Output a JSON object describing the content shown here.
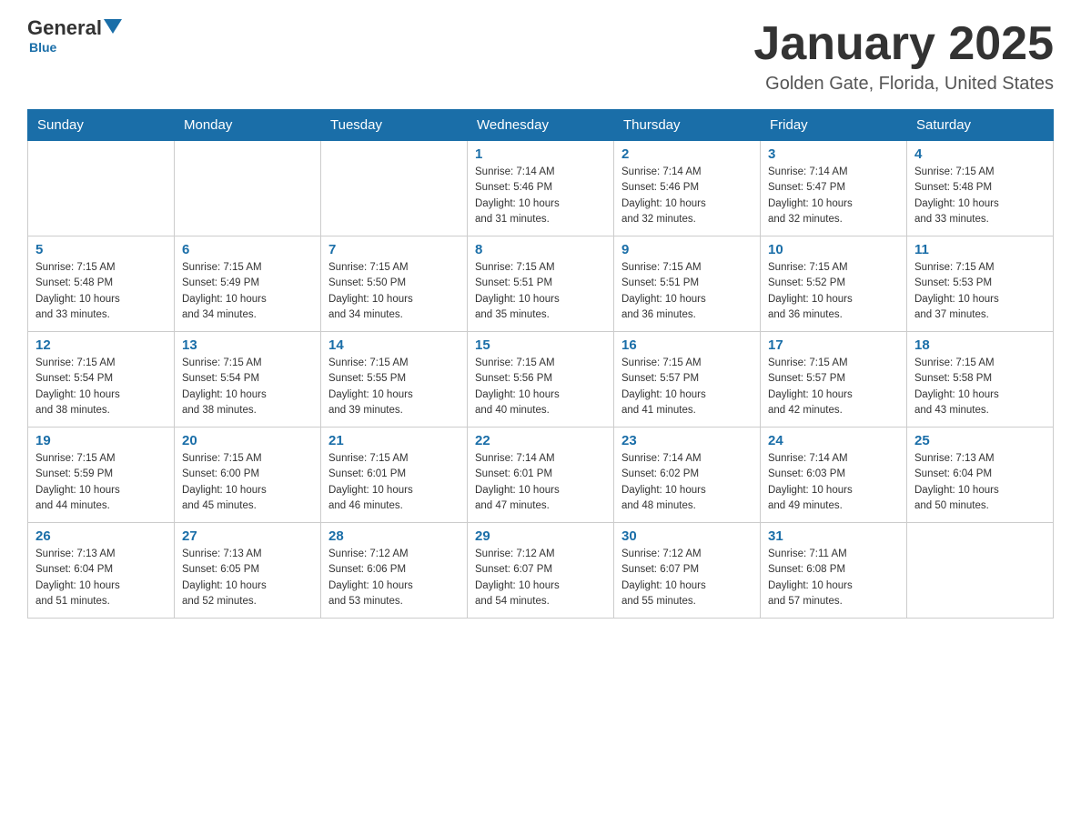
{
  "header": {
    "logo_general": "General",
    "logo_blue": "Blue",
    "month_title": "January 2025",
    "location": "Golden Gate, Florida, United States"
  },
  "columns": [
    "Sunday",
    "Monday",
    "Tuesday",
    "Wednesday",
    "Thursday",
    "Friday",
    "Saturday"
  ],
  "weeks": [
    [
      {
        "day": "",
        "info": ""
      },
      {
        "day": "",
        "info": ""
      },
      {
        "day": "",
        "info": ""
      },
      {
        "day": "1",
        "info": "Sunrise: 7:14 AM\nSunset: 5:46 PM\nDaylight: 10 hours\nand 31 minutes."
      },
      {
        "day": "2",
        "info": "Sunrise: 7:14 AM\nSunset: 5:46 PM\nDaylight: 10 hours\nand 32 minutes."
      },
      {
        "day": "3",
        "info": "Sunrise: 7:14 AM\nSunset: 5:47 PM\nDaylight: 10 hours\nand 32 minutes."
      },
      {
        "day": "4",
        "info": "Sunrise: 7:15 AM\nSunset: 5:48 PM\nDaylight: 10 hours\nand 33 minutes."
      }
    ],
    [
      {
        "day": "5",
        "info": "Sunrise: 7:15 AM\nSunset: 5:48 PM\nDaylight: 10 hours\nand 33 minutes."
      },
      {
        "day": "6",
        "info": "Sunrise: 7:15 AM\nSunset: 5:49 PM\nDaylight: 10 hours\nand 34 minutes."
      },
      {
        "day": "7",
        "info": "Sunrise: 7:15 AM\nSunset: 5:50 PM\nDaylight: 10 hours\nand 34 minutes."
      },
      {
        "day": "8",
        "info": "Sunrise: 7:15 AM\nSunset: 5:51 PM\nDaylight: 10 hours\nand 35 minutes."
      },
      {
        "day": "9",
        "info": "Sunrise: 7:15 AM\nSunset: 5:51 PM\nDaylight: 10 hours\nand 36 minutes."
      },
      {
        "day": "10",
        "info": "Sunrise: 7:15 AM\nSunset: 5:52 PM\nDaylight: 10 hours\nand 36 minutes."
      },
      {
        "day": "11",
        "info": "Sunrise: 7:15 AM\nSunset: 5:53 PM\nDaylight: 10 hours\nand 37 minutes."
      }
    ],
    [
      {
        "day": "12",
        "info": "Sunrise: 7:15 AM\nSunset: 5:54 PM\nDaylight: 10 hours\nand 38 minutes."
      },
      {
        "day": "13",
        "info": "Sunrise: 7:15 AM\nSunset: 5:54 PM\nDaylight: 10 hours\nand 38 minutes."
      },
      {
        "day": "14",
        "info": "Sunrise: 7:15 AM\nSunset: 5:55 PM\nDaylight: 10 hours\nand 39 minutes."
      },
      {
        "day": "15",
        "info": "Sunrise: 7:15 AM\nSunset: 5:56 PM\nDaylight: 10 hours\nand 40 minutes."
      },
      {
        "day": "16",
        "info": "Sunrise: 7:15 AM\nSunset: 5:57 PM\nDaylight: 10 hours\nand 41 minutes."
      },
      {
        "day": "17",
        "info": "Sunrise: 7:15 AM\nSunset: 5:57 PM\nDaylight: 10 hours\nand 42 minutes."
      },
      {
        "day": "18",
        "info": "Sunrise: 7:15 AM\nSunset: 5:58 PM\nDaylight: 10 hours\nand 43 minutes."
      }
    ],
    [
      {
        "day": "19",
        "info": "Sunrise: 7:15 AM\nSunset: 5:59 PM\nDaylight: 10 hours\nand 44 minutes."
      },
      {
        "day": "20",
        "info": "Sunrise: 7:15 AM\nSunset: 6:00 PM\nDaylight: 10 hours\nand 45 minutes."
      },
      {
        "day": "21",
        "info": "Sunrise: 7:15 AM\nSunset: 6:01 PM\nDaylight: 10 hours\nand 46 minutes."
      },
      {
        "day": "22",
        "info": "Sunrise: 7:14 AM\nSunset: 6:01 PM\nDaylight: 10 hours\nand 47 minutes."
      },
      {
        "day": "23",
        "info": "Sunrise: 7:14 AM\nSunset: 6:02 PM\nDaylight: 10 hours\nand 48 minutes."
      },
      {
        "day": "24",
        "info": "Sunrise: 7:14 AM\nSunset: 6:03 PM\nDaylight: 10 hours\nand 49 minutes."
      },
      {
        "day": "25",
        "info": "Sunrise: 7:13 AM\nSunset: 6:04 PM\nDaylight: 10 hours\nand 50 minutes."
      }
    ],
    [
      {
        "day": "26",
        "info": "Sunrise: 7:13 AM\nSunset: 6:04 PM\nDaylight: 10 hours\nand 51 minutes."
      },
      {
        "day": "27",
        "info": "Sunrise: 7:13 AM\nSunset: 6:05 PM\nDaylight: 10 hours\nand 52 minutes."
      },
      {
        "day": "28",
        "info": "Sunrise: 7:12 AM\nSunset: 6:06 PM\nDaylight: 10 hours\nand 53 minutes."
      },
      {
        "day": "29",
        "info": "Sunrise: 7:12 AM\nSunset: 6:07 PM\nDaylight: 10 hours\nand 54 minutes."
      },
      {
        "day": "30",
        "info": "Sunrise: 7:12 AM\nSunset: 6:07 PM\nDaylight: 10 hours\nand 55 minutes."
      },
      {
        "day": "31",
        "info": "Sunrise: 7:11 AM\nSunset: 6:08 PM\nDaylight: 10 hours\nand 57 minutes."
      },
      {
        "day": "",
        "info": ""
      }
    ]
  ]
}
